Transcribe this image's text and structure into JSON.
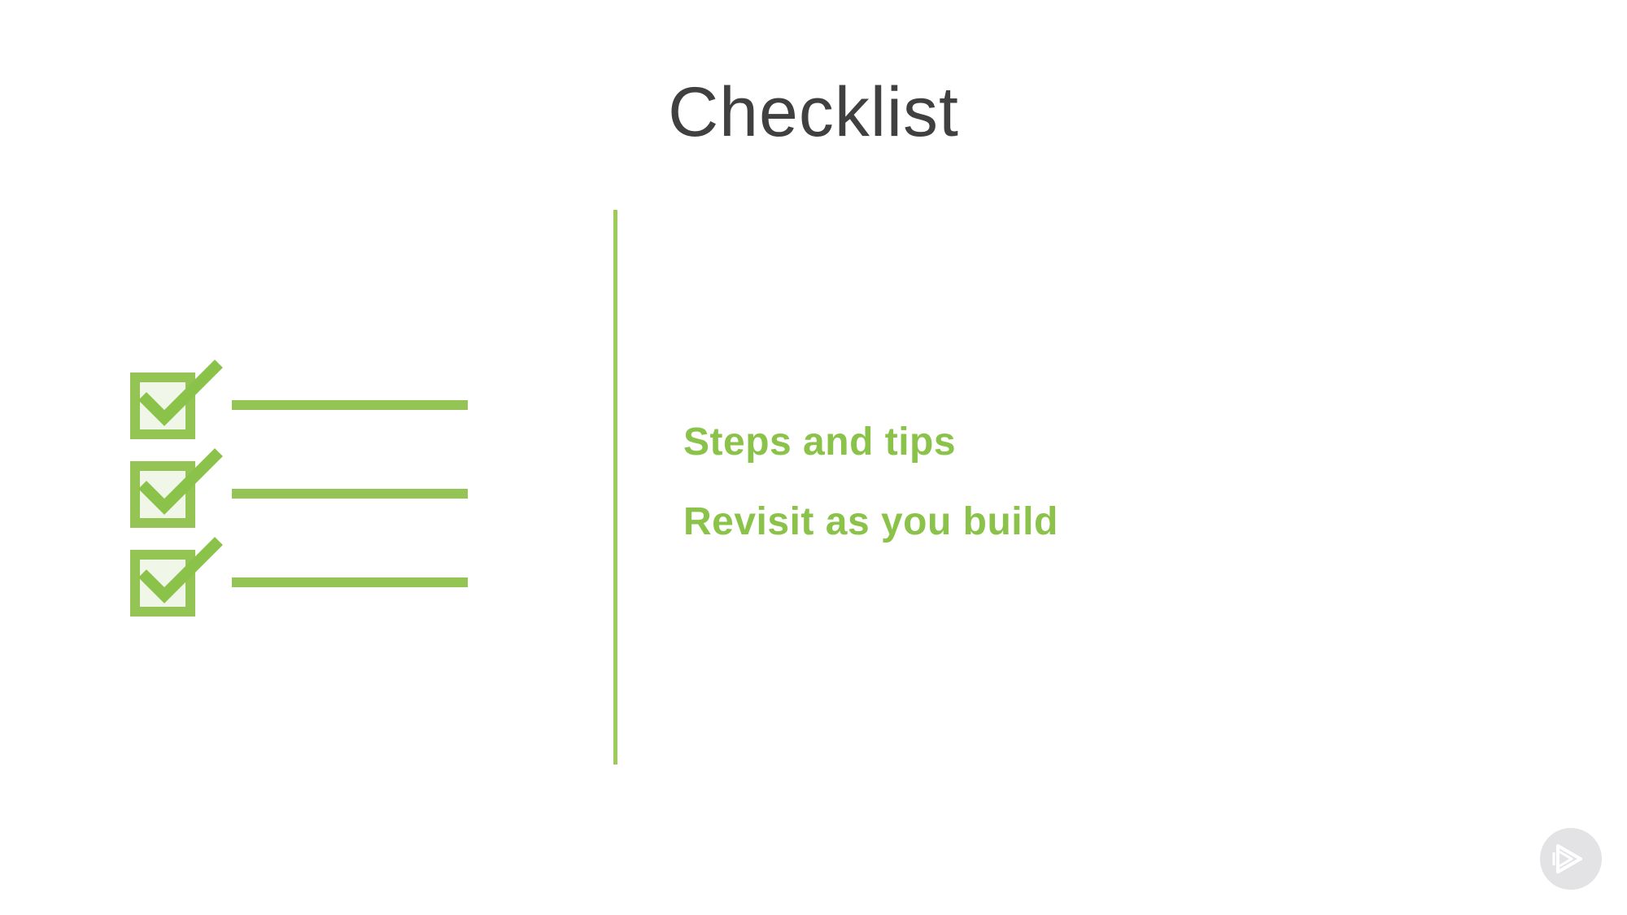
{
  "slide": {
    "title": "Checklist",
    "points": [
      "Steps and tips",
      "Revisit as you build"
    ]
  },
  "icons": {
    "checklist": "checklist-icon",
    "logo": "play-logo-icon"
  },
  "colors": {
    "accent": "#8bc34a",
    "accent_light": "#f0f7e8",
    "title": "#404040",
    "logo_bg": "#e3e3e5",
    "logo_fg": "#ffffff"
  }
}
